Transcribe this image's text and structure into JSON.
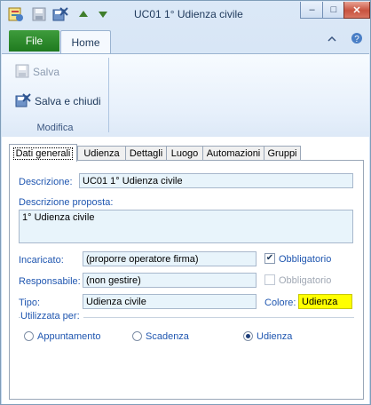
{
  "window": {
    "title": "UC01 1° Udienza civile",
    "help_label": "?",
    "minimize_label": "–",
    "maximize_label": "□",
    "close_label": "✕"
  },
  "quick_access": [
    {
      "name": "app-icon"
    },
    {
      "name": "save-icon"
    },
    {
      "name": "save-close-icon"
    },
    {
      "name": "up-arrow-icon"
    },
    {
      "name": "down-arrow-icon"
    }
  ],
  "ribbon": {
    "tabs": {
      "file": "File",
      "home": "Home"
    },
    "buttons": {
      "save": "Salva",
      "save_close": "Salva e chiudi"
    },
    "group_label": "Modifica"
  },
  "page_tabs": [
    "Dati generali",
    "Udienza",
    "Dettagli",
    "Luogo",
    "Automazioni",
    "Gruppi"
  ],
  "form": {
    "descrizione_label": "Descrizione:",
    "descrizione_value": "UC01 1° Udienza civile",
    "descrizione_proposta_label": "Descrizione proposta:",
    "descrizione_proposta_value": "1° Udienza civile",
    "incaricato_label": "Incaricato:",
    "incaricato_value": "(proporre operatore firma)",
    "obbligatorio_1": {
      "label": "Obbligatorio",
      "checked": true
    },
    "responsabile_label": "Responsabile:",
    "responsabile_value": "(non gestire)",
    "obbligatorio_2": {
      "label": "Obbligatorio",
      "checked": false
    },
    "tipo_label": "Tipo:",
    "tipo_value": "Udienza civile",
    "colore_label": "Colore:",
    "colore_value": "Udienza",
    "colore_color": "#ffff00"
  },
  "utilizzata_per": {
    "title": "Utilizzata per:",
    "options": [
      {
        "label": "Appuntamento",
        "selected": false
      },
      {
        "label": "Scadenza",
        "selected": false
      },
      {
        "label": "Udienza",
        "selected": true
      }
    ]
  },
  "colors": {
    "file_tab": "#2a8a2a",
    "label_blue": "#1f56b0",
    "field_bg": "#e8f4fb"
  }
}
